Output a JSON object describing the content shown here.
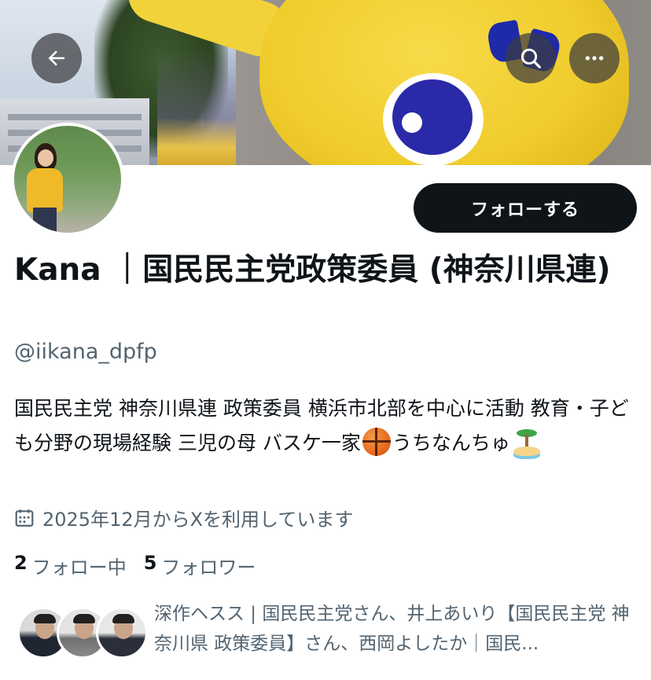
{
  "header": {
    "back_icon": "arrow-left-icon",
    "search_icon": "search-icon",
    "more_icon": "more-horizontal-icon",
    "button_bg": "#3c3c40"
  },
  "profile": {
    "display_name": "Kana ｜国民民主党政策委員 (神奈川県連)",
    "handle": "@iikana_dpfp",
    "follow_label": "フォローする",
    "bio_part1": "国民民主党 神奈川県連 政策委員 横浜市北部を中心に活動 教育・子ども分野の現場経験 三児の母 バスケ一家",
    "bio_part2": "うちなんちゅ",
    "bio_emoji_1": "basketball-emoji",
    "bio_emoji_2": "island-emoji",
    "joined_text": "2025年12月からXを利用しています",
    "following_count": "2",
    "following_label": "フォロー中",
    "followers_count": "5",
    "followers_label": "フォロワー",
    "mutuals_text": "深作ヘスス | 国民民主党さん、井上あいり【国民民主党 神奈川県 政策委員】さん、西岡よしたか｜国民..."
  },
  "colors": {
    "text_primary": "#0f1419",
    "text_secondary": "#536471",
    "follow_button": "#0f1419",
    "follow_button_text": "#ffffff"
  }
}
